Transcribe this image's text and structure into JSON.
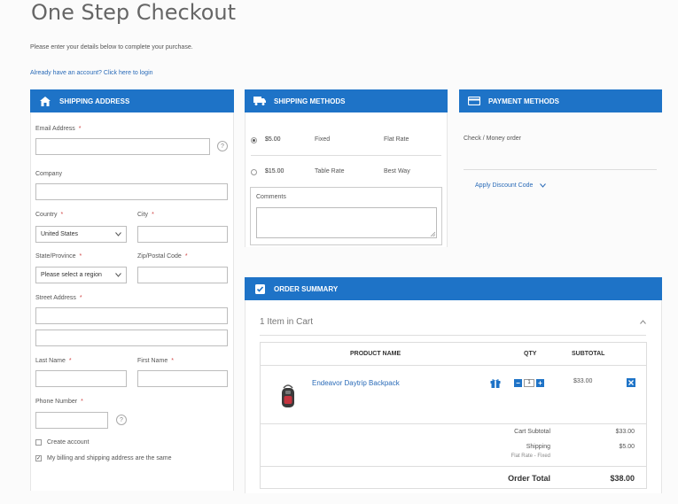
{
  "page": {
    "title": "One Step Checkout",
    "intro": "Please enter your details below to complete your purchase.",
    "login_link": "Already have an account? Click here to login"
  },
  "shipping_address": {
    "header": "SHIPPING ADDRESS",
    "email_label": "Email Address",
    "company_label": "Company",
    "country_label": "Country",
    "country_value": "United States",
    "city_label": "City",
    "state_label": "State/Province",
    "state_value": "Please select a region",
    "zip_label": "Zip/Postal Code",
    "street_label": "Street Address",
    "last_name_label": "Last Name",
    "first_name_label": "First Name",
    "phone_label": "Phone Number",
    "create_account_label": "Create account",
    "same_address_label": "My billing and shipping address are the same",
    "required_mark": "*",
    "help_mark": "?"
  },
  "shipping_methods": {
    "header": "SHIPPING METHODS",
    "options": [
      {
        "price": "$5.00",
        "method": "Fixed",
        "carrier": "Flat Rate",
        "selected": true
      },
      {
        "price": "$15.00",
        "method": "Table Rate",
        "carrier": "Best Way",
        "selected": false
      }
    ],
    "comments_label": "Comments"
  },
  "payment_methods": {
    "header": "PAYMENT METHODS",
    "option": "Check / Money order",
    "discount_label": "Apply Discount Code"
  },
  "order_summary": {
    "header": "ORDER SUMMARY",
    "items_in_cart": "1 Item in Cart",
    "columns": {
      "product": "PRODUCT NAME",
      "qty": "QTY",
      "subtotal": "SUBTOTAL"
    },
    "item": {
      "name": "Endeavor Daytrip Backpack",
      "qty": "1",
      "subtotal": "$33.00"
    },
    "totals": {
      "cart_subtotal_label": "Cart Subtotal",
      "cart_subtotal_value": "$33.00",
      "shipping_label": "Shipping",
      "shipping_sub": "Flat Rate - Fixed",
      "shipping_value": "$5.00",
      "order_total_label": "Order Total",
      "order_total_value": "$38.00"
    }
  },
  "colors": {
    "accent": "#1e73c7",
    "required": "#d04545",
    "link": "#2a6bb8"
  },
  "icons": [
    "home-icon",
    "truck-icon",
    "credit-card-icon",
    "checkbox-icon",
    "help-icon",
    "chevron-down-icon",
    "chevron-up-icon",
    "gift-icon",
    "minus-icon",
    "plus-icon",
    "remove-icon",
    "backpack-icon"
  ]
}
